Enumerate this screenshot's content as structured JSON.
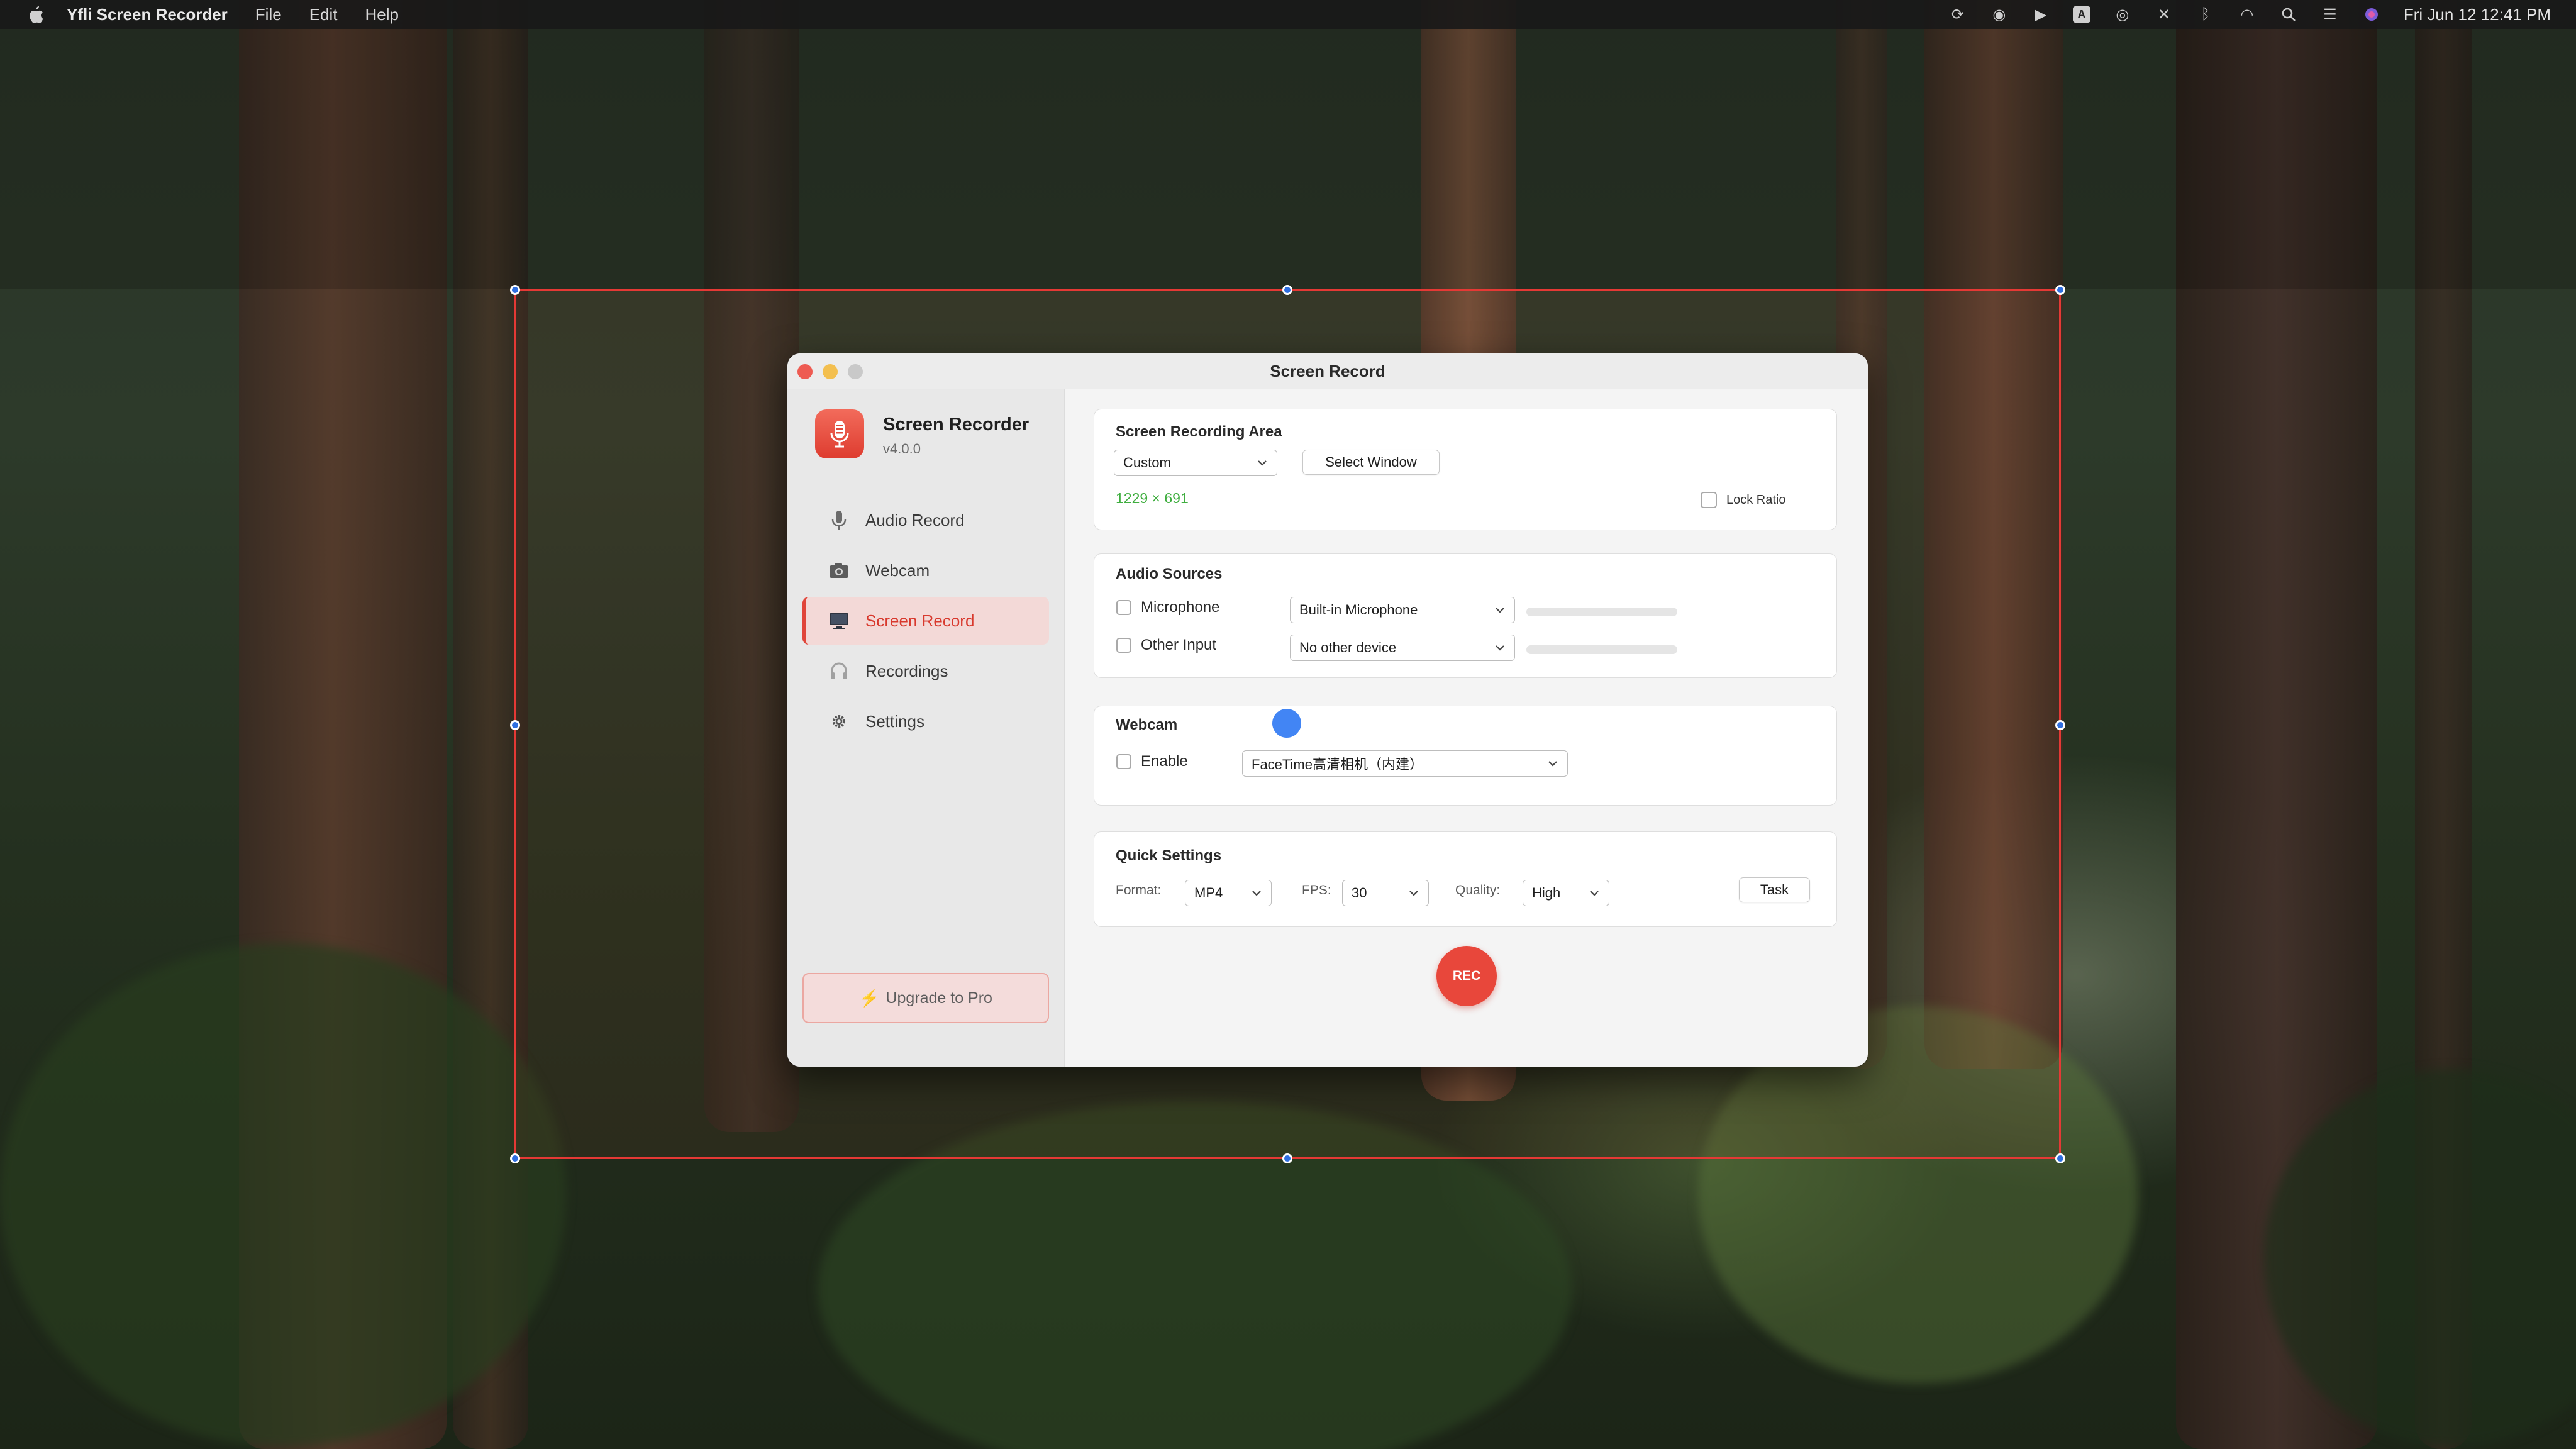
{
  "menubar": {
    "app_name": "Yfli Screen Recorder",
    "menus": [
      "File",
      "Edit",
      "Help"
    ],
    "status_icons": [
      "sync-icon",
      "paw-icon",
      "cast-icon",
      "keyboard-a-icon",
      "person-icon",
      "mute-icon",
      "bluetooth-icon",
      "wifi-icon",
      "search-icon",
      "control-center-icon",
      "siri-icon"
    ],
    "keyboard_icon_text": "A",
    "clock": "Fri Jun 12  12:41 PM"
  },
  "window": {
    "title": "Screen Record",
    "traffic_colors": {
      "close": "#ee5b52",
      "minimize": "#f3bf4f",
      "zoom": "#c9c9c9"
    }
  },
  "sidebar": {
    "app_name": "Screen Recorder",
    "version": "v4.0.0",
    "items": [
      {
        "label": "Audio Record",
        "icon": "microphone-icon",
        "active": false
      },
      {
        "label": "Webcam",
        "icon": "camera-icon",
        "active": false
      },
      {
        "label": "Screen Record",
        "icon": "monitor-icon",
        "active": true
      },
      {
        "label": "Recordings",
        "icon": "headphones-icon",
        "active": false
      },
      {
        "label": "Settings",
        "icon": "gear-icon",
        "active": false
      }
    ],
    "upgrade_label": "Upgrade to Pro"
  },
  "area": {
    "title": "Screen Recording Area",
    "mode_value": "Custom",
    "select_window_label": "Select Window",
    "size_text": "1229 × 691",
    "lock_ratio_label": "Lock Ratio",
    "lock_ratio_checked": false
  },
  "audio": {
    "title": "Audio Sources",
    "microphone_label": "Microphone",
    "microphone_device": "Built-in Microphone",
    "microphone_level": 0,
    "other_label": "Other Input",
    "other_device": "No other device",
    "other_level": 0
  },
  "webcam": {
    "title": "Webcam",
    "enable_label": "Enable",
    "device": "FaceTime高清相机（内建）"
  },
  "quick": {
    "title": "Quick Settings",
    "format_label": "Format:",
    "format_value": "MP4",
    "fps_label": "FPS:",
    "fps_value": "30",
    "quality_label": "Quality:",
    "quality_value": "High",
    "task_label": "Task"
  },
  "rec_label": "REC",
  "colors": {
    "accent": "#e0453a",
    "size_text": "#3fae3f",
    "selection_border": "#e53935",
    "handle": "#2f6fe0"
  }
}
